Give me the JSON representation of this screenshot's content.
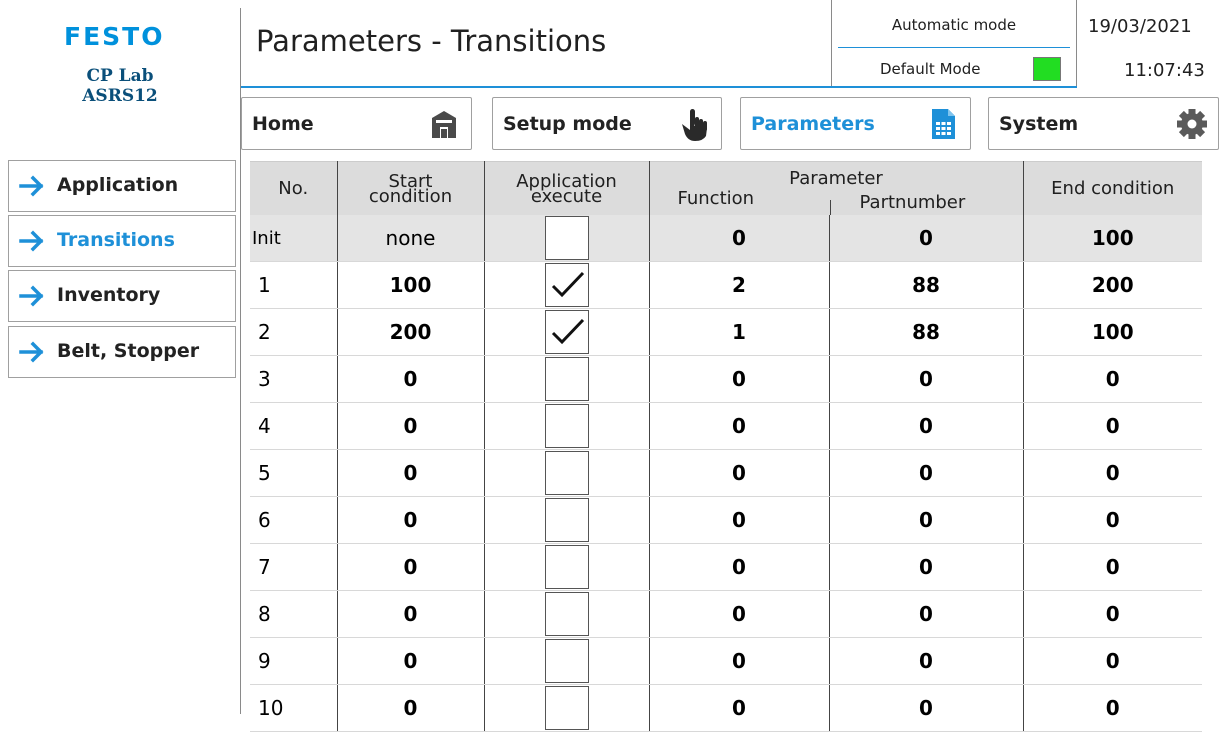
{
  "brand": {
    "logo": "FESTO",
    "line1": "CP Lab",
    "line2": "ASRS12"
  },
  "header": {
    "title": "Parameters - Transitions",
    "mode": "Automatic mode",
    "submode": "Default Mode",
    "mode_indicator_color": "#22dd22",
    "date": "19/03/2021",
    "time": "11:07:43"
  },
  "nav": [
    {
      "label": "Home",
      "icon": "home-icon"
    },
    {
      "label": "Setup mode",
      "icon": "hand-pointer-icon"
    },
    {
      "label": "Parameters",
      "icon": "parameters-document-icon",
      "active": true
    },
    {
      "label": "System",
      "icon": "gear-icon"
    }
  ],
  "sidebar": [
    {
      "label": "Application"
    },
    {
      "label": "Transitions",
      "active": true
    },
    {
      "label": "Inventory"
    },
    {
      "label": "Belt, Stopper"
    }
  ],
  "accent_color": "#1e90d8",
  "table": {
    "headers": {
      "no": "No.",
      "start_1": "Start",
      "start_2": "condition",
      "app_1": "Application",
      "app_2": "execute",
      "param": "Parameter",
      "function": "Function",
      "partnumber": "Partnumber",
      "end": "End condition"
    },
    "rows": [
      {
        "no": "Init",
        "start": "none",
        "execute": null,
        "function": "0",
        "partnumber": "0",
        "end": "100"
      },
      {
        "no": "1",
        "start": "100",
        "execute": true,
        "function": "2",
        "partnumber": "88",
        "end": "200"
      },
      {
        "no": "2",
        "start": "200",
        "execute": true,
        "function": "1",
        "partnumber": "88",
        "end": "100"
      },
      {
        "no": "3",
        "start": "0",
        "execute": false,
        "function": "0",
        "partnumber": "0",
        "end": "0"
      },
      {
        "no": "4",
        "start": "0",
        "execute": false,
        "function": "0",
        "partnumber": "0",
        "end": "0"
      },
      {
        "no": "5",
        "start": "0",
        "execute": false,
        "function": "0",
        "partnumber": "0",
        "end": "0"
      },
      {
        "no": "6",
        "start": "0",
        "execute": false,
        "function": "0",
        "partnumber": "0",
        "end": "0"
      },
      {
        "no": "7",
        "start": "0",
        "execute": false,
        "function": "0",
        "partnumber": "0",
        "end": "0"
      },
      {
        "no": "8",
        "start": "0",
        "execute": false,
        "function": "0",
        "partnumber": "0",
        "end": "0"
      },
      {
        "no": "9",
        "start": "0",
        "execute": false,
        "function": "0",
        "partnumber": "0",
        "end": "0"
      },
      {
        "no": "10",
        "start": "0",
        "execute": false,
        "function": "0",
        "partnumber": "0",
        "end": "0"
      }
    ]
  }
}
